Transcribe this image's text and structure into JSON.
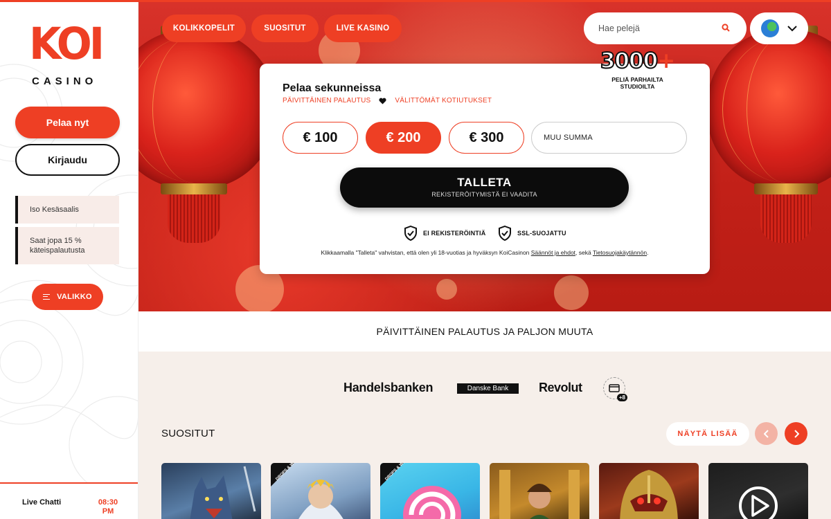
{
  "brand": {
    "logo_main": "KOI",
    "logo_sub": "CASINO",
    "accent": "#ee3f24"
  },
  "sidebar": {
    "play_label": "Pelaa nyt",
    "login_label": "Kirjaudu",
    "promos": [
      "Iso Kesäsaalis",
      "Saat jopa 15 % käteispalautusta"
    ],
    "menu_label": "VALIKKO",
    "chat_label": "Live Chatti",
    "chat_time": "08:30 PM"
  },
  "nav": {
    "tabs": [
      "KOLIKKOPELIT",
      "SUOSITUT",
      "LIVE KASINO"
    ]
  },
  "search": {
    "placeholder": "Hae pelejä",
    "icon": "search-icon"
  },
  "language": {
    "icon": "globe-icon"
  },
  "badge": {
    "number": "3000",
    "plus": "+",
    "caption": "PELIÄ PARHAILTA STUDIOILTA"
  },
  "deposit": {
    "title": "Pelaa sekunneissa",
    "feature_1": "PÄIVITTÄINEN PALAUTUS",
    "feature_2": "VÄLITTÖMÄT KOTIUTUKSET",
    "amounts": [
      "€ 100",
      "€ 200",
      "€ 300"
    ],
    "selected_amount": "€ 200",
    "other_amount_placeholder": "MUU SUMMA",
    "button_label": "TALLETA",
    "button_sub": "REKISTERÖITYMISTÄ EI VAADITA",
    "trust_1": "EI REKISTERÖINTIÄ",
    "trust_2": "SSL-SUOJATTU",
    "legal_prefix": "Klikkaamalla \"Talleta\" vahvistan, että olen yli 18-vuotias ja hyväksyn KoiCasinon ",
    "legal_link_1": "Säännöt ja ehdot",
    "legal_mid": ", sekä ",
    "legal_link_2": "Tietosuojakäytännön",
    "legal_end": "."
  },
  "strip_text": "PÄIVITTÄINEN PALAUTUS JA PALJON MUUTA",
  "payments": {
    "items": [
      "Handelsbanken",
      "Danske Bank",
      "Revolut"
    ],
    "more": "+8"
  },
  "popular": {
    "title": "SUOSITUT",
    "show_more": "NÄYTÄ LISÄÄ",
    "drops_wins": "DROPS & WINS"
  }
}
